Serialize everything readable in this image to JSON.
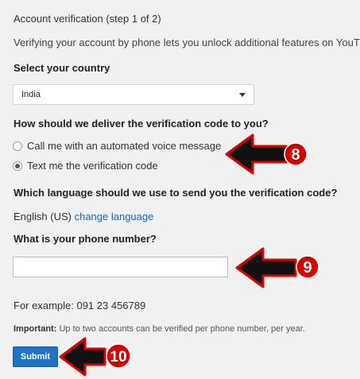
{
  "header": {
    "title": "Account verification (step 1 of 2)",
    "intro": "Verifying your account by phone lets you unlock additional features on YouTu"
  },
  "country": {
    "label": "Select your country",
    "selected": "India"
  },
  "delivery": {
    "question": "How should we deliver the verification code to you?",
    "options": [
      {
        "label": "Call me with an automated voice message",
        "checked": false
      },
      {
        "label": "Text me the verification code",
        "checked": true
      }
    ]
  },
  "language": {
    "question": "Which language should we use to send you the verification code?",
    "current": "English (US)",
    "change_link": "change language"
  },
  "phone": {
    "question": "What is your phone number?",
    "value": "",
    "example": "For example: 091 23 456789"
  },
  "note": {
    "important_label": "Important:",
    "text": "Up to two accounts can be verified per phone number, per year."
  },
  "submit_label": "Submit",
  "annotations": {
    "color": "#e00000",
    "markers": [
      "8",
      "9",
      "10"
    ]
  }
}
